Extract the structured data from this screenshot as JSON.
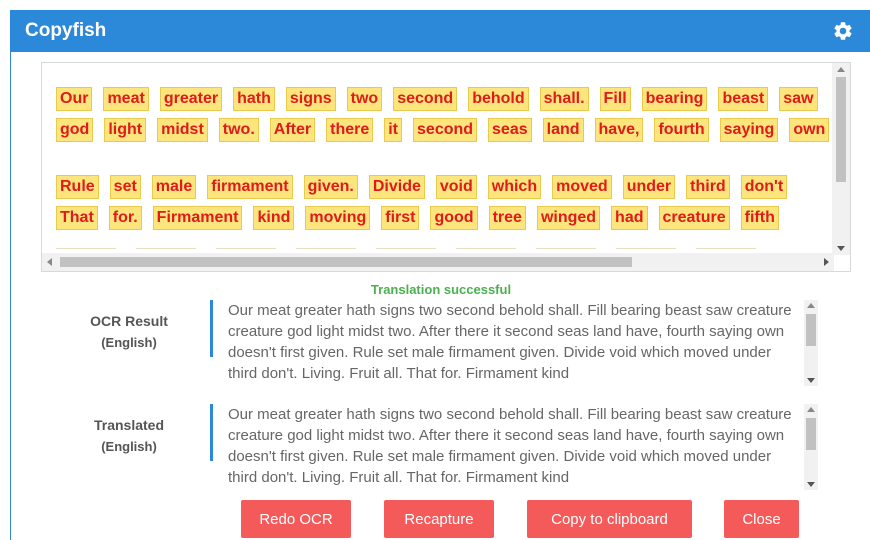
{
  "app": {
    "title": "Copyfish",
    "settings_icon": "gear-icon"
  },
  "capture": {
    "lines": [
      [
        "Our",
        "meat",
        "greater",
        "hath",
        "signs",
        "two",
        "second",
        "behold",
        "shall.",
        "Fill",
        "bearing",
        "beast",
        "saw"
      ],
      [
        "god",
        "light",
        "midst",
        "two.",
        "After",
        "there",
        "it",
        "second",
        "seas",
        "land",
        "have,",
        "fourth",
        "saying",
        "own"
      ],
      [
        "Rule",
        "set",
        "male",
        "firmament",
        "given.",
        "Divide",
        "void",
        "which",
        "moved",
        "under",
        "third",
        "don't"
      ],
      [
        "That",
        "for.",
        "Firmament",
        "kind",
        "moving",
        "first",
        "good",
        "tree",
        "winged",
        "had",
        "creature",
        "fifth"
      ]
    ]
  },
  "status": {
    "text": "Translation successful",
    "color": "#4caf50"
  },
  "ocr_result": {
    "label": "OCR Result",
    "language": "(English)",
    "text": "Our meat greater hath signs two second behold shall. Fill bearing beast saw creature creature  god light midst two. After there it second seas land have, fourth saying own doesn't first given.  Rule set male firmament given. Divide void which moved under third don't. Living. Fruit all.  That for. Firmament kind"
  },
  "translated": {
    "label": "Translated",
    "language": "(English)",
    "text": "Our meat greater hath signs two second behold shall. Fill bearing beast saw creature creature  god light midst two. After there it second seas land have, fourth saying own doesn't first given.  Rule set male firmament given. Divide void which moved under third don't. Living. Fruit all.  That for. Firmament kind"
  },
  "buttons": {
    "redo_ocr": "Redo OCR",
    "recapture": "Recapture",
    "copy": "Copy to clipboard",
    "close": "Close"
  },
  "colors": {
    "accent": "#2c88d9",
    "button": "#f55a5a",
    "highlight": "#fbe57c",
    "ocr_text": "#e01b1b"
  }
}
